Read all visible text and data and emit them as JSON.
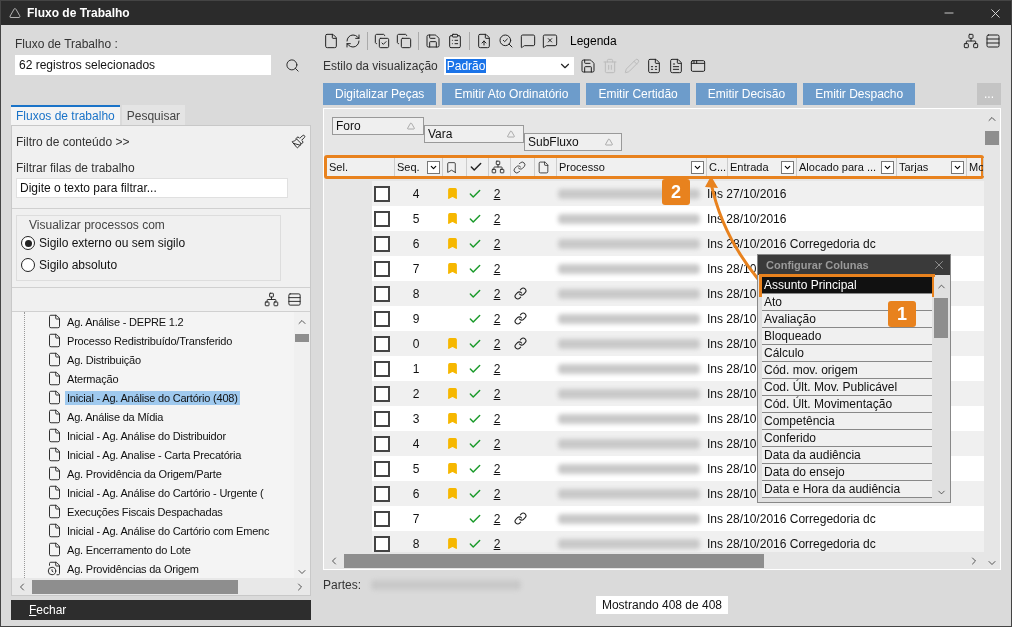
{
  "window": {
    "title": "Fluxo de Trabalho"
  },
  "left_panel": {
    "label": "Fluxo de Trabalho :",
    "field_value": "62 registros selecionados",
    "tabs": [
      {
        "label": "Fluxos de trabalho",
        "selected": true
      },
      {
        "label": "Pesquisar",
        "selected": false
      }
    ],
    "filter_link": "Filtro de conteúdo >>",
    "filter_label": "Filtrar filas de trabalho",
    "filter_placeholder": "Digite o texto para filtrar...",
    "group_title": "Visualizar processos com",
    "radios": [
      {
        "label": "Sigilo externo ou sem sigilo",
        "selected": true
      },
      {
        "label": "Sigilo absoluto",
        "selected": false
      }
    ],
    "tree": [
      {
        "label": "Ag. Análise - DEPRE 1.2",
        "selected": false,
        "kind": "queue"
      },
      {
        "label": "Processo Redistribuído/Transferido",
        "selected": false,
        "kind": "queue"
      },
      {
        "label": "Ag. Distribuição",
        "selected": false,
        "kind": "queue"
      },
      {
        "label": "Atermação",
        "selected": false,
        "kind": "queue"
      },
      {
        "label": "Inicial - Ag. Análise do Cartório (408)",
        "selected": true,
        "kind": "queue"
      },
      {
        "label": "Ag. Análise da Mídia",
        "selected": false,
        "kind": "queue"
      },
      {
        "label": "Inicial  - Ag. Análise do Distribuidor",
        "selected": false,
        "kind": "queue"
      },
      {
        "label": "Inicial - Ag. Analise - Carta Precatória",
        "selected": false,
        "kind": "queue"
      },
      {
        "label": "Ag. Providência da Origem/Parte",
        "selected": false,
        "kind": "queue"
      },
      {
        "label": "Inicial - Ag. Análise do Cartório - Urgente (",
        "selected": false,
        "kind": "queue"
      },
      {
        "label": "Execuções Fiscais Despachadas",
        "selected": false,
        "kind": "queue"
      },
      {
        "label": "Inicial - Ag. Análise do Cartório com Emenc",
        "selected": false,
        "kind": "queue"
      },
      {
        "label": "Ag. Encerramento do Lote",
        "selected": false,
        "kind": "queue"
      },
      {
        "label": "Ag. Providências da Origem",
        "selected": false,
        "kind": "timed"
      }
    ],
    "close_button": "Fechar"
  },
  "toolbar": {
    "legend": "Legenda"
  },
  "view_style": {
    "label": "Estilo da visualização",
    "value": "Padrão"
  },
  "action_buttons": [
    "Digitalizar Peças",
    "Emitir Ato Ordinatório",
    "Emitir Certidão",
    "Emitir Decisão",
    "Emitir Despacho"
  ],
  "more_button": "...",
  "group_by": [
    "Foro",
    "Vara",
    "SubFluxo"
  ],
  "table": {
    "columns": [
      {
        "kind": "text",
        "label": "Sel.",
        "filter": false
      },
      {
        "kind": "text",
        "label": "Seq.",
        "filter": true
      },
      {
        "kind": "bookmark",
        "filter": false
      },
      {
        "kind": "check",
        "filter": false
      },
      {
        "kind": "tree",
        "filter": false
      },
      {
        "kind": "link",
        "filter": false
      },
      {
        "kind": "document",
        "filter": false
      },
      {
        "kind": "text",
        "label": "Processo",
        "filter": true
      },
      {
        "kind": "text",
        "label": "C...",
        "filter": false
      },
      {
        "kind": "text",
        "label": "Entrada",
        "filter": true
      },
      {
        "kind": "text",
        "label": "Alocado para ...",
        "filter": true
      },
      {
        "kind": "text",
        "label": "Tarjas",
        "filter": true
      },
      {
        "kind": "text",
        "label": "Mo",
        "filter": false
      }
    ],
    "rows": [
      {
        "checked": false,
        "seq": "4",
        "bookmarked": true,
        "confirmed": true,
        "count": "2",
        "linked": false,
        "entrada": "Ins 27/10/2016"
      },
      {
        "checked": false,
        "seq": "5",
        "bookmarked": true,
        "confirmed": true,
        "count": "2",
        "linked": false,
        "entrada": "Ins 28/10/2016"
      },
      {
        "checked": false,
        "seq": "6",
        "bookmarked": true,
        "confirmed": true,
        "count": "2",
        "linked": false,
        "entrada": "Ins 28/10/2016 Corregedoria dc"
      },
      {
        "checked": false,
        "seq": "7",
        "bookmarked": true,
        "confirmed": true,
        "count": "2",
        "linked": false,
        "entrada": "Ins 28/10"
      },
      {
        "checked": false,
        "seq": "8",
        "bookmarked": false,
        "confirmed": true,
        "count": "2",
        "linked": true,
        "entrada": "Ins 28/10"
      },
      {
        "checked": false,
        "seq": "9",
        "bookmarked": false,
        "confirmed": true,
        "count": "2",
        "linked": true,
        "entrada": "Ins 28/10"
      },
      {
        "checked": false,
        "seq": "0",
        "bookmarked": true,
        "confirmed": true,
        "count": "2",
        "linked": true,
        "entrada": "Ins 28/10"
      },
      {
        "checked": false,
        "seq": "1",
        "bookmarked": true,
        "confirmed": true,
        "count": "2",
        "linked": false,
        "entrada": "Ins 28/10"
      },
      {
        "checked": false,
        "seq": "2",
        "bookmarked": true,
        "confirmed": true,
        "count": "2",
        "linked": false,
        "entrada": "Ins 28/10"
      },
      {
        "checked": false,
        "seq": "3",
        "bookmarked": true,
        "confirmed": true,
        "count": "2",
        "linked": false,
        "entrada": "Ins 28/10"
      },
      {
        "checked": false,
        "seq": "4",
        "bookmarked": true,
        "confirmed": true,
        "count": "2",
        "linked": false,
        "entrada": "Ins 28/10"
      },
      {
        "checked": false,
        "seq": "5",
        "bookmarked": true,
        "confirmed": true,
        "count": "2",
        "linked": false,
        "entrada": "Ins 28/10"
      },
      {
        "checked": false,
        "seq": "6",
        "bookmarked": true,
        "confirmed": true,
        "count": "2",
        "linked": false,
        "entrada": "Ins 28/10"
      },
      {
        "checked": false,
        "seq": "7",
        "bookmarked": false,
        "confirmed": true,
        "count": "2",
        "linked": true,
        "entrada": "Ins 28/10/2016 Corregedoria dc"
      },
      {
        "checked": false,
        "seq": "8",
        "bookmarked": true,
        "confirmed": true,
        "count": "2",
        "linked": false,
        "entrada": "Ins 28/10/2016 Corregedoria dc"
      }
    ]
  },
  "column_popup": {
    "title": "Configurar Colunas",
    "items": [
      {
        "label": "Assunto Principal",
        "selected": true
      },
      {
        "label": "Ato",
        "selected": false
      },
      {
        "label": "Avaliação",
        "selected": false
      },
      {
        "label": "Bloqueado",
        "selected": false
      },
      {
        "label": "Cálculo",
        "selected": false
      },
      {
        "label": "Cód. mov. origem",
        "selected": false
      },
      {
        "label": "Cod. Últ. Mov. Publicável",
        "selected": false
      },
      {
        "label": "Cód. Últ. Movimentação",
        "selected": false
      },
      {
        "label": "Competência",
        "selected": false
      },
      {
        "label": "Conferido",
        "selected": false
      },
      {
        "label": "Data da audiência",
        "selected": false
      },
      {
        "label": "Data do ensejo",
        "selected": false
      },
      {
        "label": "Data e Hora da audiência",
        "selected": false
      }
    ]
  },
  "callouts": [
    "1",
    "2"
  ],
  "footer": {
    "partes_label": "Partes:",
    "status": "Mostrando 408 de 408"
  }
}
